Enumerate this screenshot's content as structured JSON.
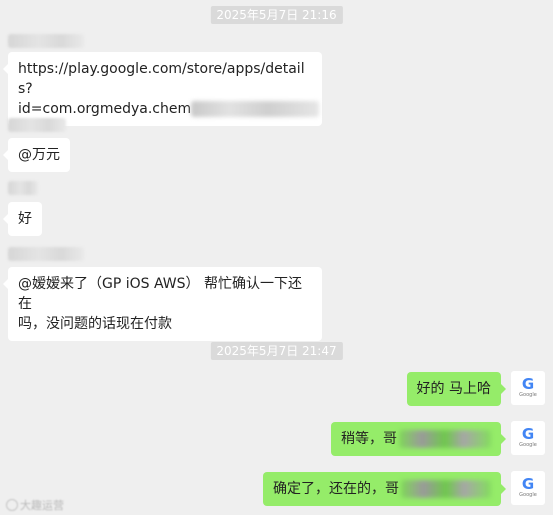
{
  "timestamps": [
    "2025年5月7日 21:16",
    "2025年5月7日 21:47"
  ],
  "messages_left": [
    {
      "url_line1": "https://play.google.com/store/apps/details?",
      "url_line2": "id=com.orgmedya.chem"
    },
    {
      "text": "@万元"
    },
    {
      "text": "好"
    },
    {
      "line1": "@嫒嫒来了（GP iOS AWS） 帮忙确认一下还在",
      "line2": "吗，没问题的话现在付款"
    }
  ],
  "messages_right": [
    {
      "text": "好的 马上哈"
    },
    {
      "text": "稍等，哥"
    },
    {
      "text": "确定了，还在的，哥"
    }
  ],
  "avatar": {
    "icon": "google-logo",
    "letter": "G",
    "caption": "Google",
    "color": "#4285f4"
  },
  "watermark": {
    "text": "大趣运营"
  },
  "colors": {
    "background": "#efefef",
    "bubble_left": "#ffffff",
    "bubble_right": "#95ec69",
    "timestamp_bg": "#dadada"
  }
}
